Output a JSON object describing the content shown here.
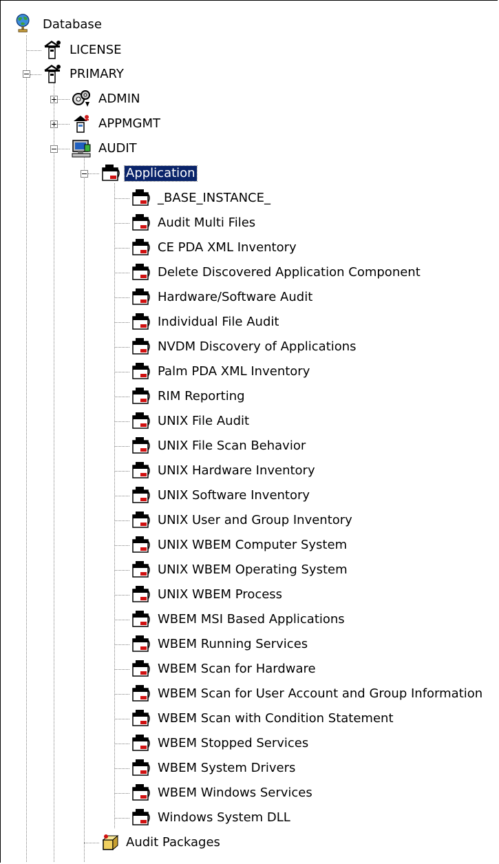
{
  "tree": {
    "root": {
      "label": "Database",
      "icon": "globe-icon"
    },
    "license": {
      "label": "LICENSE",
      "icon": "config-class-icon"
    },
    "primary": {
      "label": "PRIMARY",
      "icon": "config-class-icon",
      "state": "expanded"
    },
    "admin": {
      "label": "ADMIN",
      "icon": "admin-gears-icon",
      "state": "collapsed"
    },
    "appmgmt": {
      "label": "APPMGMT",
      "icon": "appmgmt-icon",
      "state": "collapsed"
    },
    "audit": {
      "label": "AUDIT",
      "icon": "computer-audit-icon",
      "state": "expanded"
    },
    "application": {
      "label": "Application",
      "icon": "application-class-icon",
      "state": "expanded",
      "selected": true
    },
    "instances": [
      "_BASE_INSTANCE_",
      "Audit Multi Files",
      "CE PDA XML Inventory",
      "Delete Discovered Application Component",
      "Hardware/Software Audit",
      "Individual File Audit",
      "NVDM Discovery of Applications",
      "Palm PDA XML Inventory",
      "RIM Reporting",
      "UNIX File Audit",
      "UNIX File Scan Behavior",
      "UNIX Hardware Inventory",
      "UNIX Software Inventory",
      "UNIX User and Group Inventory",
      "UNIX WBEM Computer System",
      "UNIX WBEM Operating System",
      "UNIX WBEM Process",
      "WBEM MSI Based Applications",
      "WBEM Running Services",
      "WBEM Scan for Hardware",
      "WBEM Scan for User Account and Group Information",
      "WBEM Scan with Condition Statement",
      "WBEM Stopped Services",
      "WBEM System Drivers",
      "WBEM Windows Services",
      "Windows System DLL"
    ],
    "instance_icon": "application-instance-icon",
    "audit_packages": {
      "label": "Audit Packages",
      "icon": "audit-packages-icon"
    }
  },
  "colors": {
    "selection_bg": "#0a246a",
    "selection_fg": "#ffffff",
    "tree_lines": "#808080"
  }
}
